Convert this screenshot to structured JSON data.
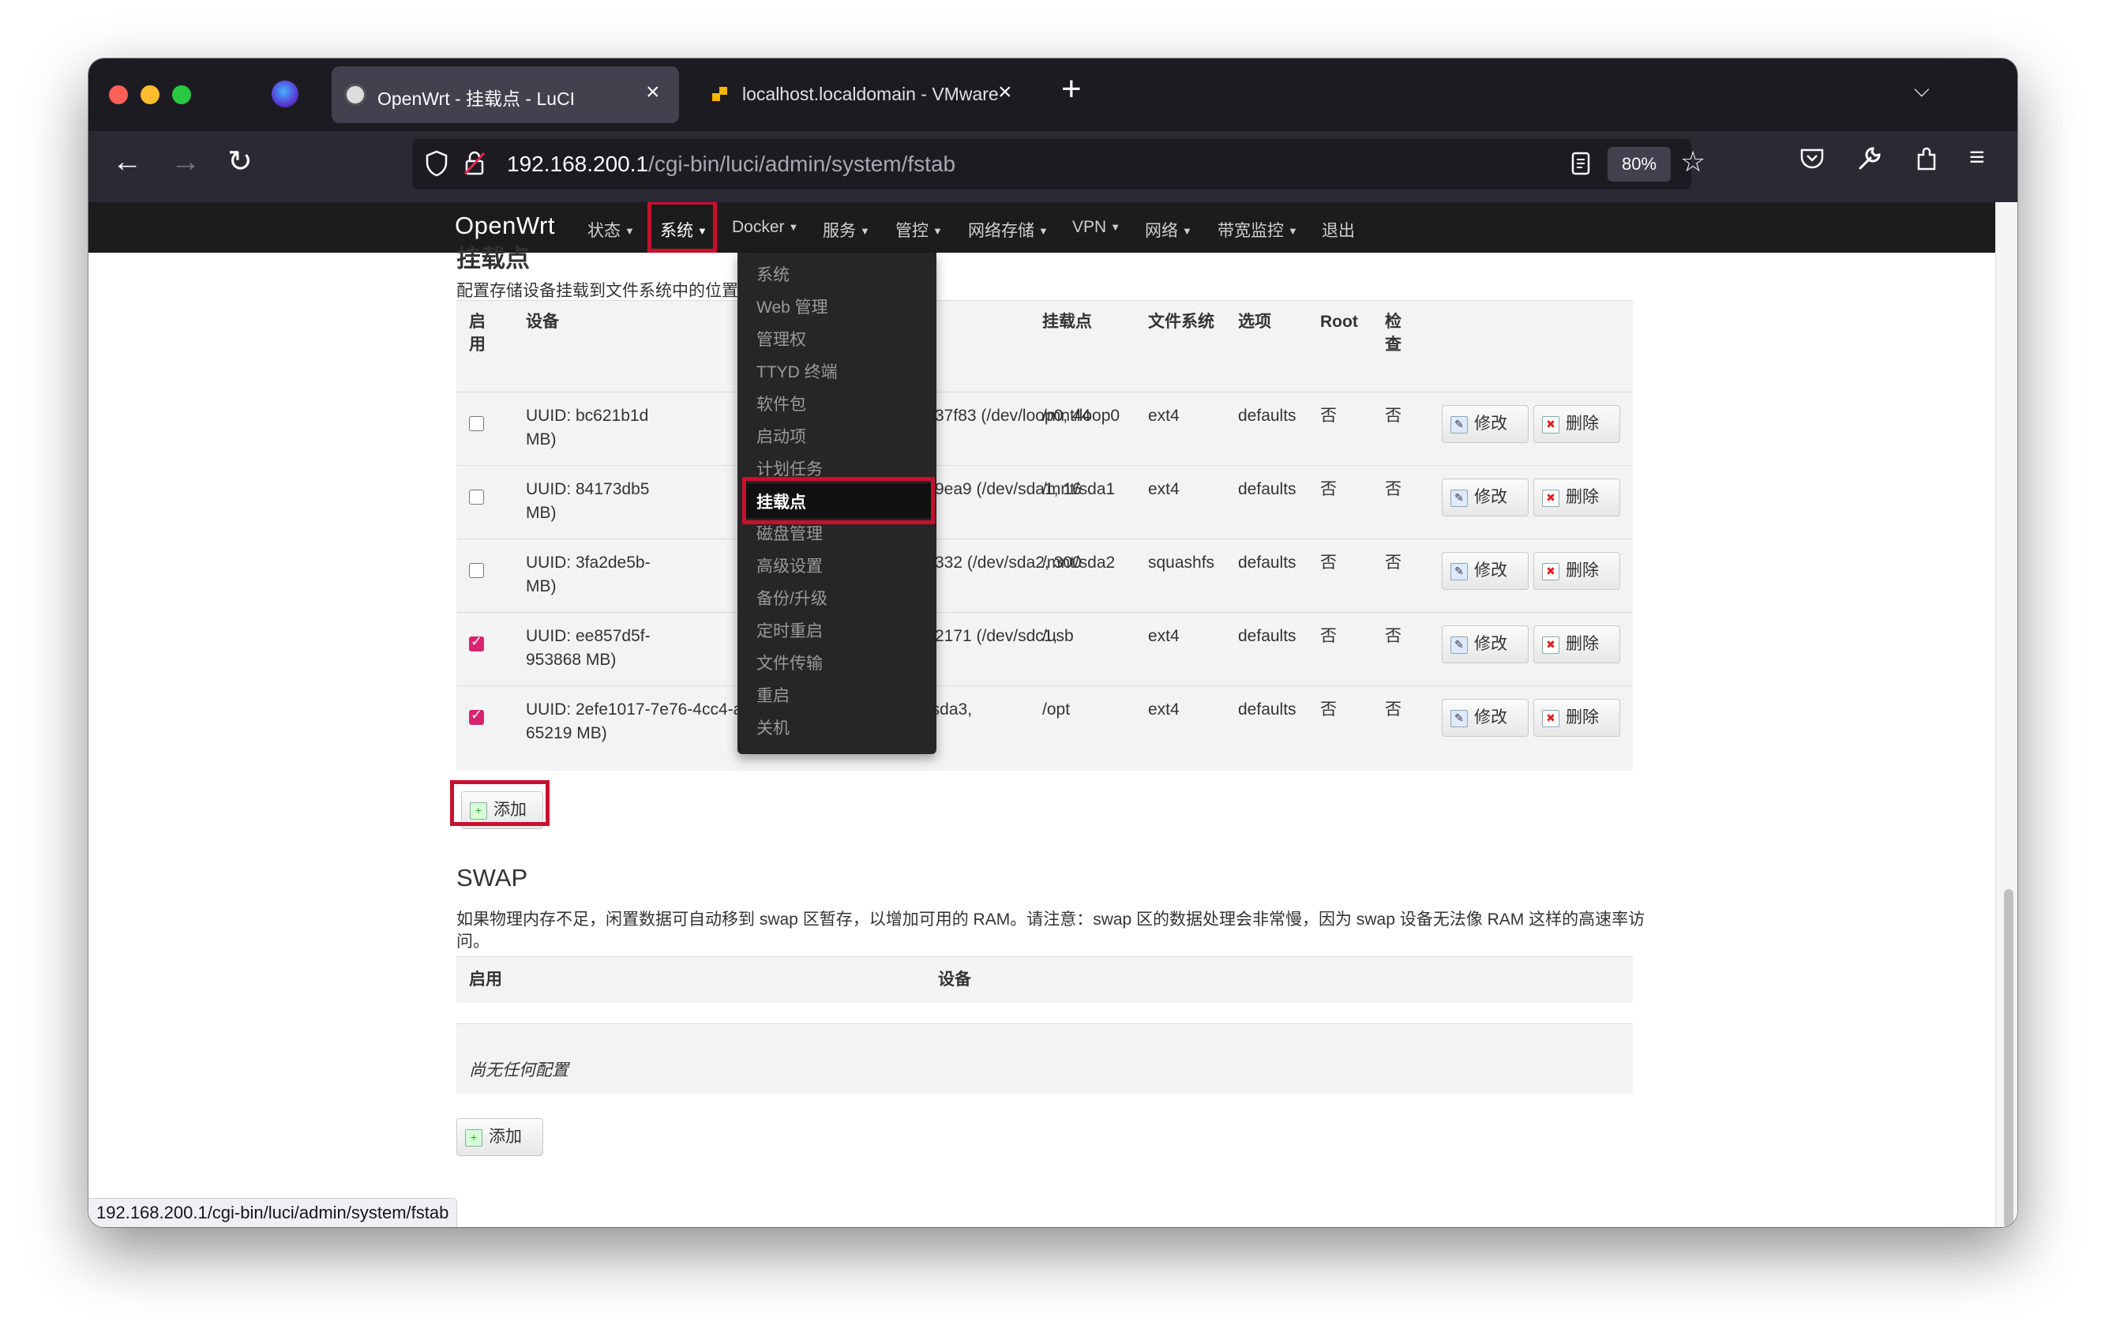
{
  "browser": {
    "tabs": [
      {
        "title": "OpenWrt - 挂载点 - LuCI",
        "active": true
      },
      {
        "title": "localhost.localdomain - VMware",
        "active": false
      }
    ],
    "url_host": "192.168.200.1",
    "url_path": "/cgi-bin/luci/admin/system/fstab",
    "zoom": "80%",
    "status_url": "192.168.200.1/cgi-bin/luci/admin/system/fstab"
  },
  "luci": {
    "logo": "OpenWrt",
    "menu": [
      "状态",
      "系统",
      "Docker",
      "服务",
      "管控",
      "网络存储",
      "VPN",
      "网络",
      "带宽监控",
      "退出"
    ],
    "dropdown": [
      "系统",
      "Web 管理",
      "管理权",
      "TTYD 终端",
      "软件包",
      "启动项",
      "计划任务",
      "挂载点",
      "磁盘管理",
      "高级设置",
      "备份/升级",
      "定时重启",
      "文件传输",
      "重启",
      "关机"
    ],
    "dropdown_active": "挂载点"
  },
  "mounts": {
    "title": "挂载点",
    "desc": "配置存储设备挂载到文件系统中的位置和参数。",
    "headers": {
      "enable": "启\n用",
      "device": "设备",
      "mountpoint": "挂载点",
      "fs": "文件系统",
      "options": "选项",
      "root": "Root",
      "check": "检\n查"
    },
    "rows": [
      {
        "enabled": false,
        "device1": "UUID: bc621b1d",
        "device1b": "37f83 (/dev/loop0, 44",
        "device2": "MB)",
        "mount": "/mnt/loop0",
        "fs": "ext4",
        "options": "defaults",
        "root": "否",
        "check": "否"
      },
      {
        "enabled": false,
        "device1": "UUID: 84173db5",
        "device1b": "9ea9 (/dev/sda1, 16",
        "device2": "MB)",
        "mount": "/mnt/sda1",
        "fs": "ext4",
        "options": "defaults",
        "root": "否",
        "check": "否"
      },
      {
        "enabled": false,
        "device1": "UUID: 3fa2de5b-",
        "device1b": "332 (/dev/sda2, 300",
        "device2": "MB)",
        "mount": "/mnt/sda2",
        "fs": "squashfs",
        "options": "defaults",
        "root": "否",
        "check": "否"
      },
      {
        "enabled": true,
        "device1": "UUID: ee857d5f-",
        "device1b": "2171 (/dev/sdc1,",
        "device2": "953868 MB)",
        "mount": "/usb",
        "fs": "ext4",
        "options": "defaults",
        "root": "否",
        "check": "否"
      },
      {
        "enabled": true,
        "device1": "UUID: 2efe1017-7e76-4cc4-a9cb-5b34d576b987 (/dev/sda3,",
        "device1b": "",
        "device2": "65219 MB)",
        "mount": "/opt",
        "fs": "ext4",
        "options": "defaults",
        "root": "否",
        "check": "否"
      }
    ],
    "edit_label": "修改",
    "delete_label": "删除",
    "add_label": "添加"
  },
  "swap": {
    "title": "SWAP",
    "desc1": "如果物理内存不足，闲置数据可自动移到 swap 区暂存，以增加可用的 RAM。请注意：swap 区的数据处理会非常慢，因为 swap 设备无法像 RAM 这样的高速率访",
    "desc2": "问。",
    "header_enable": "启用",
    "header_device": "设备",
    "empty": "尚无任何配置",
    "add_label": "添加"
  }
}
